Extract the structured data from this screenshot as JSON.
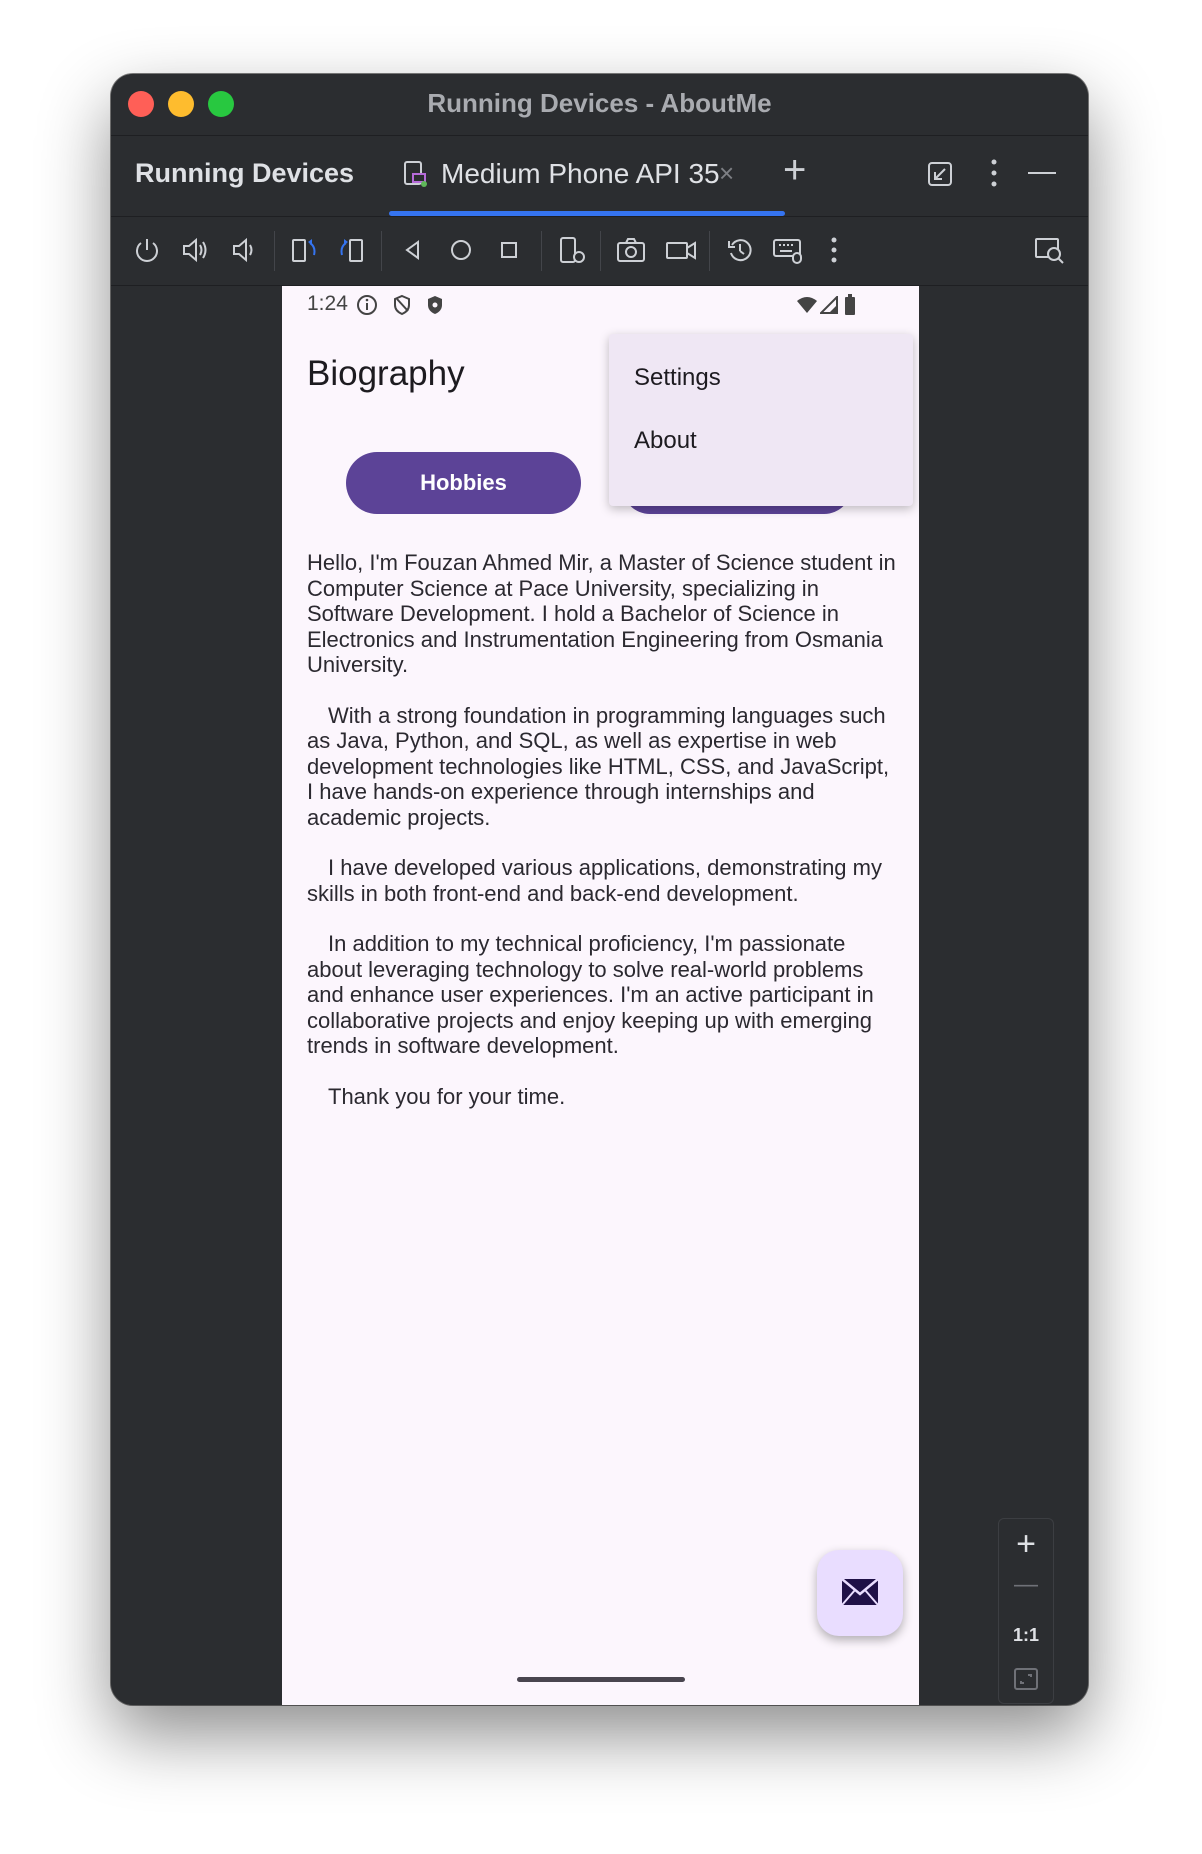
{
  "window": {
    "title": "Running Devices - AboutMe"
  },
  "tabbar": {
    "panel_label": "Running Devices",
    "tab_label": "Medium Phone API 35",
    "close_glyph": "×",
    "add_glyph": "+"
  },
  "toolbar": {
    "icons": [
      "power-icon",
      "volume-up-icon",
      "volume-down-icon",
      "rotate-left-icon",
      "rotate-right-icon",
      "back-icon",
      "home-icon",
      "overview-icon",
      "device-settings-icon",
      "camera-icon",
      "record-icon",
      "reset-icon",
      "keyboard-icon",
      "more-icon",
      "inspect-icon"
    ]
  },
  "phone": {
    "status": {
      "time": "1:24"
    },
    "app_title": "Biography",
    "hobbies_button": "Hobbies",
    "menu": {
      "items": [
        "Settings",
        "About"
      ]
    },
    "bio": [
      "Hello, I'm Fouzan Ahmed Mir, a Master of Science student in Computer Science at Pace University, specializing in Software Development. I hold a Bachelor of Science in Electronics and Instrumentation Engineering from Osmania University.",
      "With a strong foundation in programming languages such as Java, Python, and SQL, as well as expertise in web development technologies like HTML, CSS, and JavaScript, I have hands-on experience through internships and academic projects.",
      "I have developed various applications, demonstrating my skills in both front-end and back-end development.",
      "In addition to my technical proficiency, I'm passionate about leveraging technology to solve real-world problems and enhance user experiences. I'm an active participant in collaborative projects and enjoy keeping up with emerging trends in software development.",
      "Thank you for your time."
    ]
  },
  "zoom": {
    "plus": "+",
    "minus": "—",
    "actual": "1:1"
  },
  "colors": {
    "accent": "#3574f0",
    "button": "#5c4397",
    "fab": "#e9ddff"
  }
}
